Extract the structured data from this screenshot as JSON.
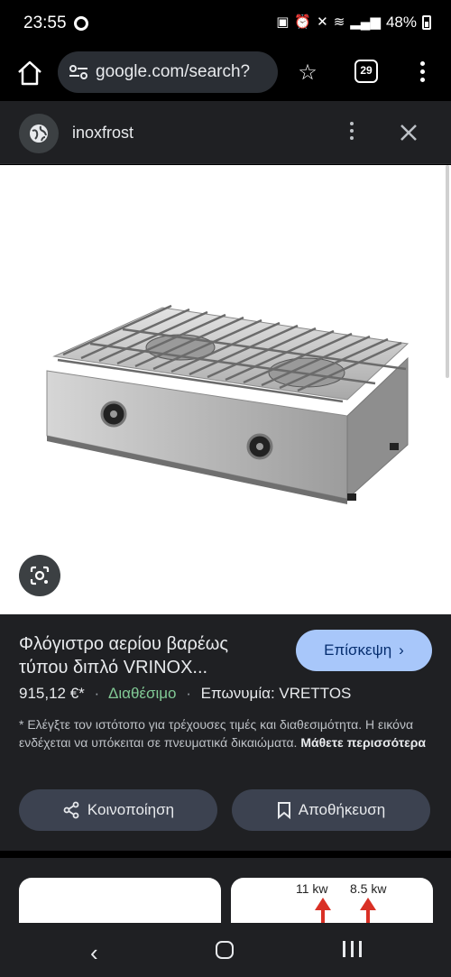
{
  "status_bar": {
    "time": "23:55",
    "battery": "48%"
  },
  "toolbar": {
    "url": "google.com/search?",
    "tab_count": "29"
  },
  "header": {
    "site_name": "inoxfrost"
  },
  "product": {
    "title": "Φλόγιστρο αερίου βαρέως τύπου διπλό VRINOX...",
    "visit_label": "Επίσκεψη",
    "price": "915,12 €*",
    "availability": "Διαθέσιμο",
    "brand": "Επωνυμία: VRETTOS",
    "disclaimer": "* Ελέγξτε τον ιστότοπο για τρέχουσες τιμές και διαθεσιμότητα. Η εικόνα ενδέχεται να υπόκειται σε πνευματικά δικαιώματα.",
    "learn_more": "Μάθετε περισσότερα",
    "share_label": "Κοινοποίηση",
    "save_label": "Αποθήκευση"
  },
  "related": {
    "kw_a": "11 kw",
    "kw_b": "8.5 kw"
  },
  "colors": {
    "availability": "#81c995",
    "visit_button": "#a8c7fa",
    "panel_background": "#1f2023"
  }
}
